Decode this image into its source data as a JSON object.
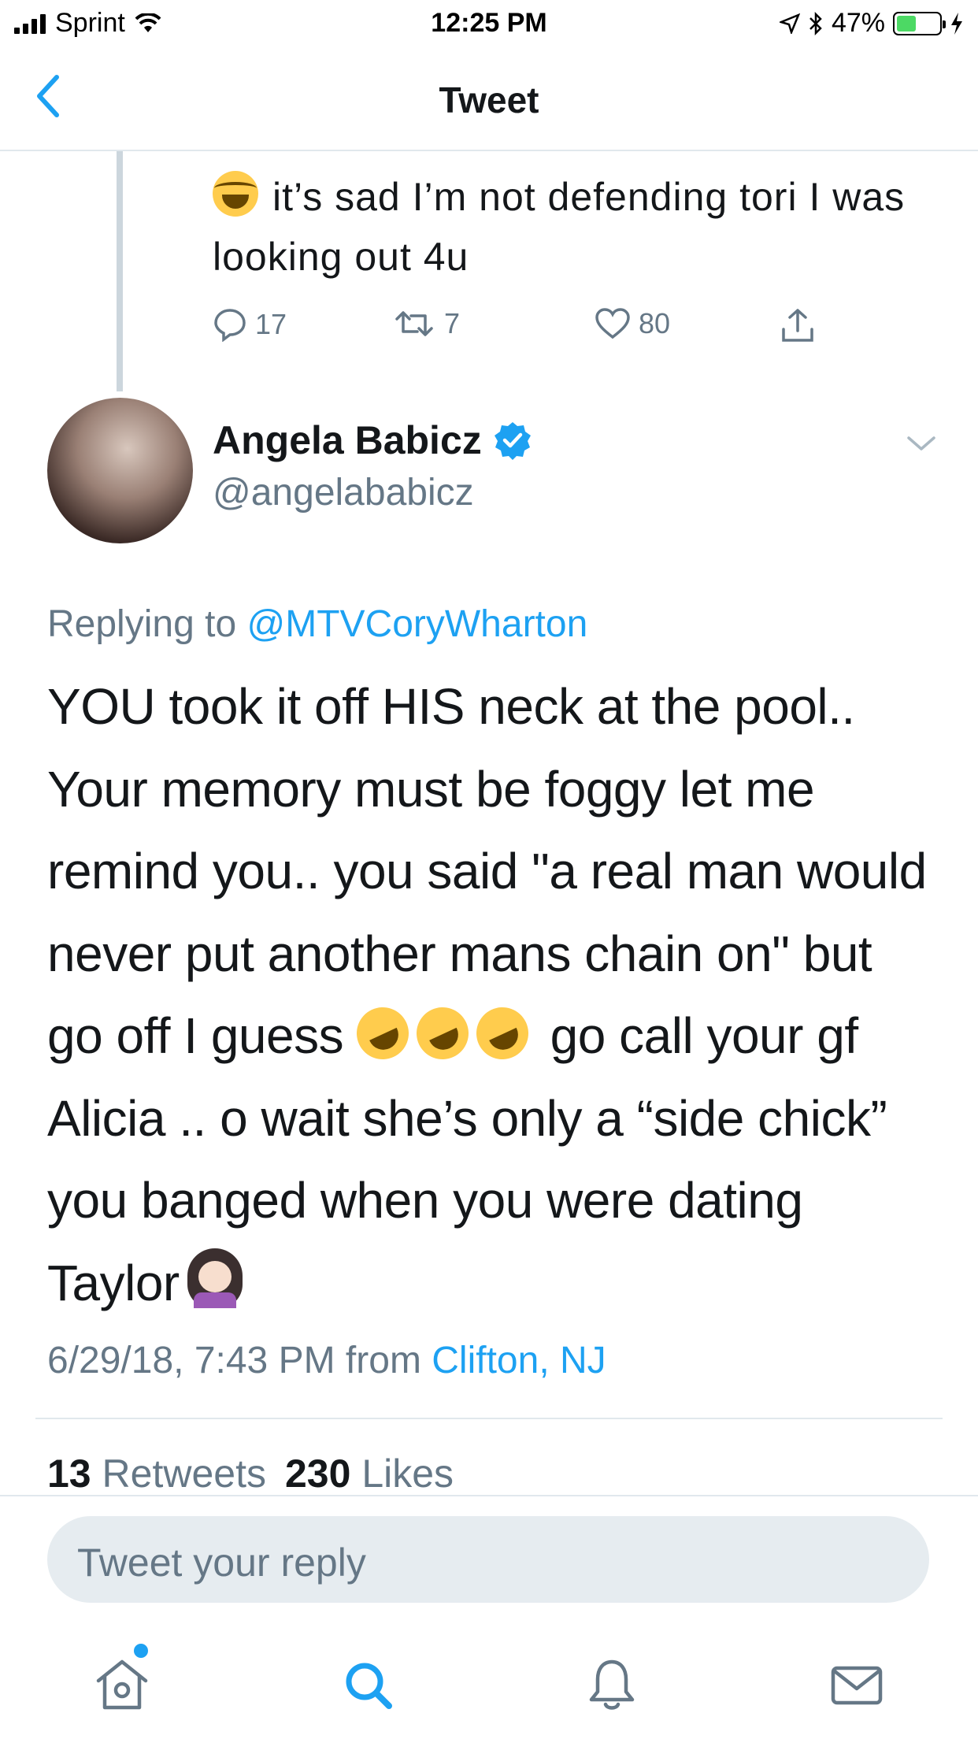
{
  "status_bar": {
    "carrier": "Sprint",
    "time": "12:25 PM",
    "battery_percent": "47%",
    "battery_level": 0.47
  },
  "nav": {
    "title": "Tweet"
  },
  "parent_tweet": {
    "text": "it’s sad I’m not defending tori I was looking out 4u",
    "replies": "17",
    "retweets": "7",
    "likes": "80"
  },
  "tweet": {
    "author_name": "Angela Babicz",
    "author_handle": "@angelababicz",
    "replying_prefix": "Replying to",
    "replying_to": "@MTVCoryWharton",
    "body_part1": "YOU took it off HIS neck at the pool.. Your memory must be foggy let me remind you.. you said \"a real man would never put another mans chain on\" but go off I guess",
    "body_part2": "go call your gf Alicia .. o wait she’s only a “side chick” you banged when you were dating Taylor",
    "date": "6/29/18, 7:43 PM",
    "from_label": "from",
    "location": "Clifton, NJ"
  },
  "stats": {
    "retweets_count": "13",
    "retweets_label": "Retweets",
    "likes_count": "230",
    "likes_label": "Likes"
  },
  "reply": {
    "placeholder": "Tweet your reply"
  },
  "colors": {
    "accent": "#1da1f2",
    "secondary_text": "#657786",
    "primary_text": "#14171a"
  }
}
